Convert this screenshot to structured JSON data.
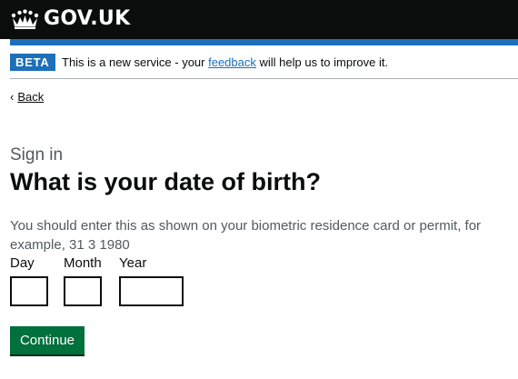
{
  "header": {
    "logo_text": "GOV.UK",
    "logo_icon": "crown-icon"
  },
  "phase_banner": {
    "tag": "BETA",
    "text_before": "This is a new service - your ",
    "link_text": "feedback",
    "text_after": " will help us to improve it."
  },
  "back_link": {
    "chevron": "‹",
    "label": "Back"
  },
  "main": {
    "caption": "Sign in",
    "heading": "What is your date of birth?",
    "hint": "You should enter this as shown on your biometric residence card or permit, for example, 31 3 1980"
  },
  "date_fields": {
    "day_label": "Day",
    "month_label": "Month",
    "year_label": "Year",
    "day_value": "",
    "month_value": "",
    "year_value": ""
  },
  "continue_button": {
    "label": "Continue"
  },
  "colors": {
    "header_bg": "#0b0c0c",
    "brand_blue": "#1d70b8",
    "button_green": "#00703c",
    "hint_grey": "#505a5f"
  }
}
